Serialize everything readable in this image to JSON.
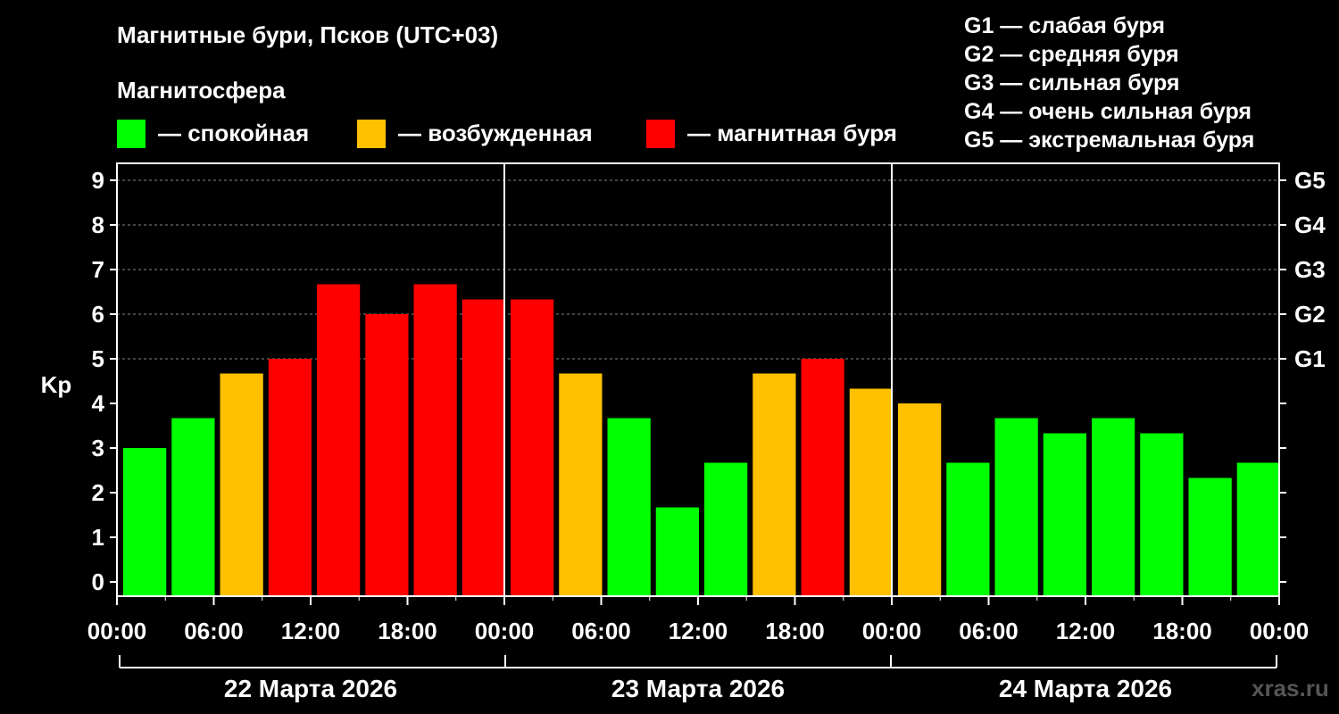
{
  "header": {
    "title": "Магнитные бури, Псков (UTC+03)",
    "magnetosphere_label": "Магнитосфера"
  },
  "legend": {
    "calm": {
      "label": "— спокойная",
      "color": "#00ff00"
    },
    "active": {
      "label": "— возбужденная",
      "color": "#ffc000"
    },
    "storm": {
      "label": "— магнитная буря",
      "color": "#ff0000"
    }
  },
  "g_scale": [
    "G1 — слабая буря",
    "G2 — средняя буря",
    "G3 — сильная буря",
    "G4 — очень сильная буря",
    "G5 — экстремальная буря"
  ],
  "watermark": "xras.ru",
  "chart_data": {
    "type": "bar",
    "ylabel": "Kp",
    "ylim": [
      0,
      9
    ],
    "yticks": [
      "0",
      "1",
      "2",
      "3",
      "4",
      "5",
      "6",
      "7",
      "8",
      "9"
    ],
    "right_axis": [
      {
        "value": 5,
        "label": "G1"
      },
      {
        "value": 6,
        "label": "G2"
      },
      {
        "value": 7,
        "label": "G3"
      },
      {
        "value": 8,
        "label": "G4"
      },
      {
        "value": 9,
        "label": "G5"
      }
    ],
    "x_tick_labels": [
      "00:00",
      "06:00",
      "12:00",
      "18:00",
      "00:00",
      "06:00",
      "12:00",
      "18:00",
      "00:00",
      "06:00",
      "12:00",
      "18:00",
      "00:00"
    ],
    "days": [
      "22 Марта 2026",
      "23 Марта 2026",
      "24 Марта 2026"
    ],
    "interval_hours": 3,
    "values": [
      3.0,
      3.67,
      4.67,
      5.0,
      6.67,
      6.0,
      6.67,
      6.33,
      6.33,
      4.67,
      3.67,
      1.67,
      2.67,
      4.67,
      5.0,
      4.33,
      4.0,
      2.67,
      3.67,
      3.33,
      3.67,
      3.33,
      2.33,
      2.67
    ],
    "colors": {
      "calm": "#00ff00",
      "active": "#ffc000",
      "storm": "#ff0000"
    },
    "grid": true
  }
}
